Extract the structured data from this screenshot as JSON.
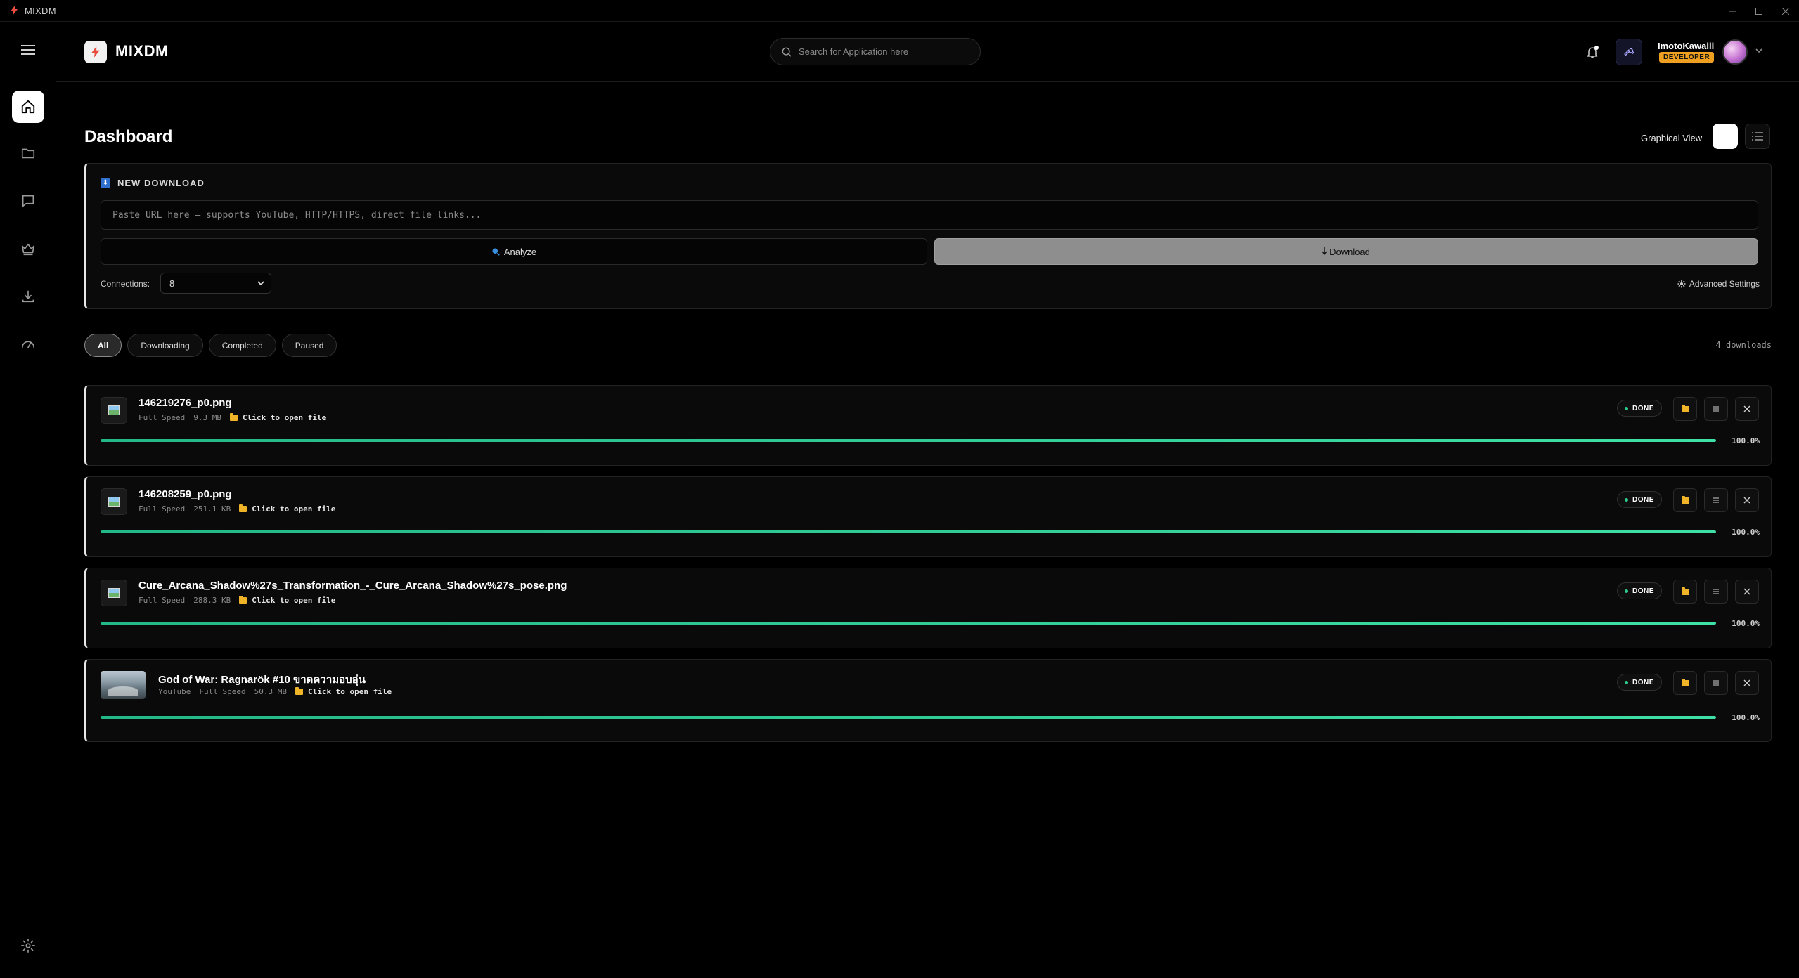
{
  "window": {
    "title": "MIXDM"
  },
  "header": {
    "logo_text": "MIXDM",
    "search_placeholder": "Search for Application here",
    "user_name": "ImotoKawaiii",
    "user_badge": "DEVELOPER"
  },
  "sidebar": {
    "items": [
      {
        "name": "home",
        "icon": "home-icon",
        "active": true
      },
      {
        "name": "files",
        "icon": "folder-icon",
        "active": false
      },
      {
        "name": "messages",
        "icon": "chat-icon",
        "active": false
      },
      {
        "name": "premium",
        "icon": "crown-icon",
        "active": false
      },
      {
        "name": "downloads",
        "icon": "download-icon",
        "active": false
      },
      {
        "name": "speed",
        "icon": "speedometer-icon",
        "active": false
      }
    ],
    "bottom_icon": "gear-icon"
  },
  "main": {
    "title": "Dashboard",
    "view_label": "Graphical View",
    "new_download": {
      "title": "NEW DOWNLOAD",
      "url_placeholder": "Paste URL here — supports YouTube, HTTP/HTTPS, direct file links...",
      "analyze_label": "Analyze",
      "download_label": "Download",
      "connections_label": "Connections:",
      "connections_value": "8",
      "advanced_label": "Advanced Settings"
    },
    "filters": [
      "All",
      "Downloading",
      "Completed",
      "Paused"
    ],
    "active_filter": "All",
    "count_text": "4 downloads",
    "downloads": [
      {
        "filename": "146219276_p0.png",
        "source": "",
        "speed": "Full Speed",
        "size": "9.3 MB",
        "open_label": "Click to open file",
        "status": "DONE",
        "progress": 100,
        "progress_text": "100.0%",
        "thumb": "image"
      },
      {
        "filename": "146208259_p0.png",
        "source": "",
        "speed": "Full Speed",
        "size": "251.1 KB",
        "open_label": "Click to open file",
        "status": "DONE",
        "progress": 100,
        "progress_text": "100.0%",
        "thumb": "image"
      },
      {
        "filename": "Cure_Arcana_Shadow%27s_Transformation_-_Cure_Arcana_Shadow%27s_pose.png",
        "source": "",
        "speed": "Full Speed",
        "size": "288.3 KB",
        "open_label": "Click to open file",
        "status": "DONE",
        "progress": 100,
        "progress_text": "100.0%",
        "thumb": "image"
      },
      {
        "filename": "God of War: Ragnarök #10 ขาดความอบอุ่น",
        "source": "YouTube",
        "speed": "Full Speed",
        "size": "50.3 MB",
        "open_label": "Click to open file",
        "status": "DONE",
        "progress": 100,
        "progress_text": "100.0%",
        "thumb": "video"
      }
    ]
  },
  "colors": {
    "background": "#000000",
    "accent_progress": "#2ecc8a",
    "developer_badge": "#f0a020",
    "folder": "#f0b429"
  }
}
